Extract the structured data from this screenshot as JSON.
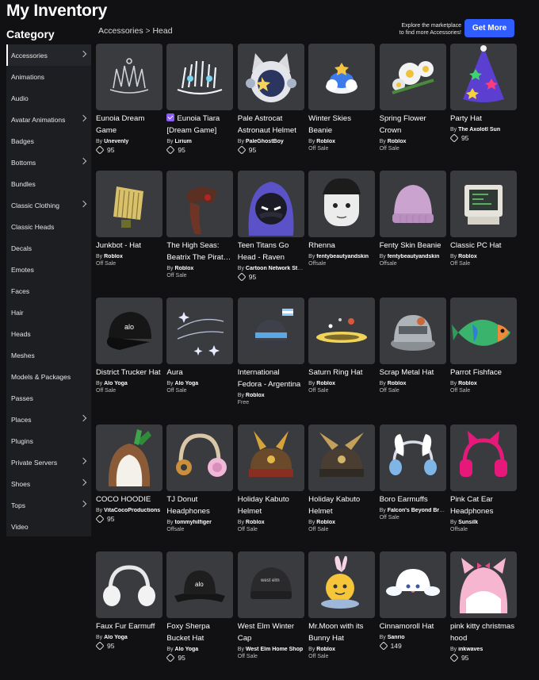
{
  "header": {
    "title": "My Inventory",
    "category_heading": "Category",
    "explore_line1": "Explore the marketplace",
    "explore_line2": "to find more Accessories!",
    "get_more_label": "Get More"
  },
  "breadcrumb": {
    "parent": "Accessories",
    "separator": ">",
    "current": "Head"
  },
  "sidebar": {
    "items": [
      {
        "label": "Accessories",
        "chevron": true,
        "active": true
      },
      {
        "label": "Animations",
        "chevron": false
      },
      {
        "label": "Audio",
        "chevron": false
      },
      {
        "label": "Avatar Animations",
        "chevron": true
      },
      {
        "label": "Badges",
        "chevron": false
      },
      {
        "label": "Bottoms",
        "chevron": true
      },
      {
        "label": "Bundles",
        "chevron": false
      },
      {
        "label": "Classic Clothing",
        "chevron": true
      },
      {
        "label": "Classic Heads",
        "chevron": false
      },
      {
        "label": "Decals",
        "chevron": false
      },
      {
        "label": "Emotes",
        "chevron": false
      },
      {
        "label": "Faces",
        "chevron": false
      },
      {
        "label": "Hair",
        "chevron": false
      },
      {
        "label": "Heads",
        "chevron": false
      },
      {
        "label": "Meshes",
        "chevron": false
      },
      {
        "label": "Models & Packages",
        "chevron": false
      },
      {
        "label": "Passes",
        "chevron": false
      },
      {
        "label": "Places",
        "chevron": true
      },
      {
        "label": "Plugins",
        "chevron": false
      },
      {
        "label": "Private Servers",
        "chevron": true
      },
      {
        "label": "Shoes",
        "chevron": true
      },
      {
        "label": "Tops",
        "chevron": true
      },
      {
        "label": "Video",
        "chevron": false
      }
    ]
  },
  "items": [
    {
      "name": "Eunoia Dream Game",
      "by": "By",
      "creator": "Unevenly",
      "price": "95",
      "offsale": false,
      "icon": "silver-tiara-icon"
    },
    {
      "name": "Eunoia Tiara [Dream Game]",
      "by": "By",
      "creator": "Lirium",
      "price": "95",
      "offsale": false,
      "verified": true,
      "icon": "white-tiara-icon"
    },
    {
      "name": "Pale Astrocat Astronaut Helmet",
      "by": "By",
      "creator": "PaleGhostBoy",
      "price": "95",
      "offsale": false,
      "icon": "astrocat-helmet-icon"
    },
    {
      "name": "Winter Skies Beanie",
      "by": "By",
      "creator": "Roblox",
      "price": "Off Sale",
      "offsale": true,
      "icon": "cloud-beanie-icon"
    },
    {
      "name": "Spring Flower Crown",
      "by": "By",
      "creator": "Roblox",
      "price": "Off Sale",
      "offsale": true,
      "icon": "flower-crown-icon"
    },
    {
      "name": "Party Hat",
      "by": "By",
      "creator": "The Axolotl Sun",
      "price": "95",
      "offsale": false,
      "icon": "party-hat-icon"
    },
    {
      "name": "Junkbot - Hat",
      "by": "By",
      "creator": "Roblox",
      "price": "Off Sale",
      "offsale": true,
      "icon": "junkbot-hat-icon"
    },
    {
      "name": "The High Seas: Beatrix The Pirate Queen",
      "by": "By",
      "creator": "Roblox",
      "price": "Off Sale",
      "offsale": true,
      "icon": "pirate-hair-icon"
    },
    {
      "name": "Teen Titans Go Head - Raven",
      "by": "By",
      "creator": "Cartoon Network Studios",
      "price": "95",
      "offsale": false,
      "icon": "raven-head-icon"
    },
    {
      "name": "Rhenna",
      "by": "By",
      "creator": "fentybeautyandskin",
      "price": "Offsale",
      "offsale": true,
      "icon": "rhenna-head-icon"
    },
    {
      "name": "Fenty Skin Beanie",
      "by": "By",
      "creator": "fentybeautyandskin",
      "price": "Offsale",
      "offsale": true,
      "icon": "pink-beanie-icon"
    },
    {
      "name": "Classic PC Hat",
      "by": "By",
      "creator": "Roblox",
      "price": "Off Sale",
      "offsale": true,
      "icon": "pc-hat-icon"
    },
    {
      "name": "District Trucker Hat",
      "by": "By",
      "creator": "Alo Yoga",
      "price": "Off Sale",
      "offsale": true,
      "icon": "trucker-hat-icon"
    },
    {
      "name": "Aura",
      "by": "By",
      "creator": "Alo Yoga",
      "price": "Off Sale",
      "offsale": true,
      "icon": "aura-sparkle-icon"
    },
    {
      "name": "International Fedora - Argentina",
      "by": "By",
      "creator": "Roblox",
      "price": "Free",
      "offsale": true,
      "icon": "fedora-icon"
    },
    {
      "name": "Saturn Ring Hat",
      "by": "By",
      "creator": "Roblox",
      "price": "Off Sale",
      "offsale": true,
      "icon": "saturn-ring-icon"
    },
    {
      "name": "Scrap Metal Hat",
      "by": "By",
      "creator": "Roblox",
      "price": "Off Sale",
      "offsale": true,
      "icon": "scrap-metal-hat-icon"
    },
    {
      "name": "Parrot Fishface",
      "by": "By",
      "creator": "Roblox",
      "price": "Off Sale",
      "offsale": true,
      "icon": "parrot-fish-icon"
    },
    {
      "name": "COCO HOODIE",
      "by": "By",
      "creator": "VitaCocoProductions",
      "price": "95",
      "offsale": false,
      "icon": "coconut-hoodie-icon"
    },
    {
      "name": "TJ Donut Headphones",
      "by": "By",
      "creator": "tommyhilfiger",
      "price": "Offsale",
      "offsale": true,
      "icon": "donut-headphones-icon"
    },
    {
      "name": "Holiday Kabuto Helmet",
      "by": "By",
      "creator": "Roblox",
      "price": "Off Sale",
      "offsale": true,
      "icon": "kabuto-gold-icon"
    },
    {
      "name": "Holiday Kabuto Helmet",
      "by": "By",
      "creator": "Roblox",
      "price": "Off Sale",
      "offsale": true,
      "icon": "kabuto-dark-icon"
    },
    {
      "name": "Boro Earmuffs",
      "by": "By",
      "creator": "Falcon's Beyond Brands",
      "price": "Off Sale",
      "offsale": true,
      "icon": "bunny-earmuffs-icon"
    },
    {
      "name": "Pink Cat Ear Headphones",
      "by": "By",
      "creator": "Sunsilk",
      "price": "Offsale",
      "offsale": true,
      "icon": "cat-ear-headphones-icon"
    },
    {
      "name": "Faux Fur Earmuff",
      "by": "By",
      "creator": "Alo Yoga",
      "price": "95",
      "offsale": false,
      "icon": "fur-earmuff-icon"
    },
    {
      "name": "Foxy Sherpa Bucket Hat",
      "by": "By",
      "creator": "Alo Yoga",
      "price": "95",
      "offsale": false,
      "icon": "bucket-hat-icon"
    },
    {
      "name": "West Elm Winter Cap",
      "by": "By",
      "creator": "West Elm Home Shop",
      "price": "Off Sale",
      "offsale": true,
      "icon": "winter-cap-icon"
    },
    {
      "name": "Mr.Moon with its Bunny Hat",
      "by": "By",
      "creator": "Roblox",
      "price": "Off Sale",
      "offsale": true,
      "icon": "moon-bunny-hat-icon"
    },
    {
      "name": "Cinnamoroll Hat",
      "by": "By",
      "creator": "Sanrio",
      "price": "149",
      "offsale": false,
      "icon": "cinnamoroll-hat-icon"
    },
    {
      "name": "pink kitty christmas hood",
      "by": "By",
      "creator": "inkwaves",
      "price": "95",
      "offsale": false,
      "icon": "kitty-hood-icon"
    }
  ]
}
